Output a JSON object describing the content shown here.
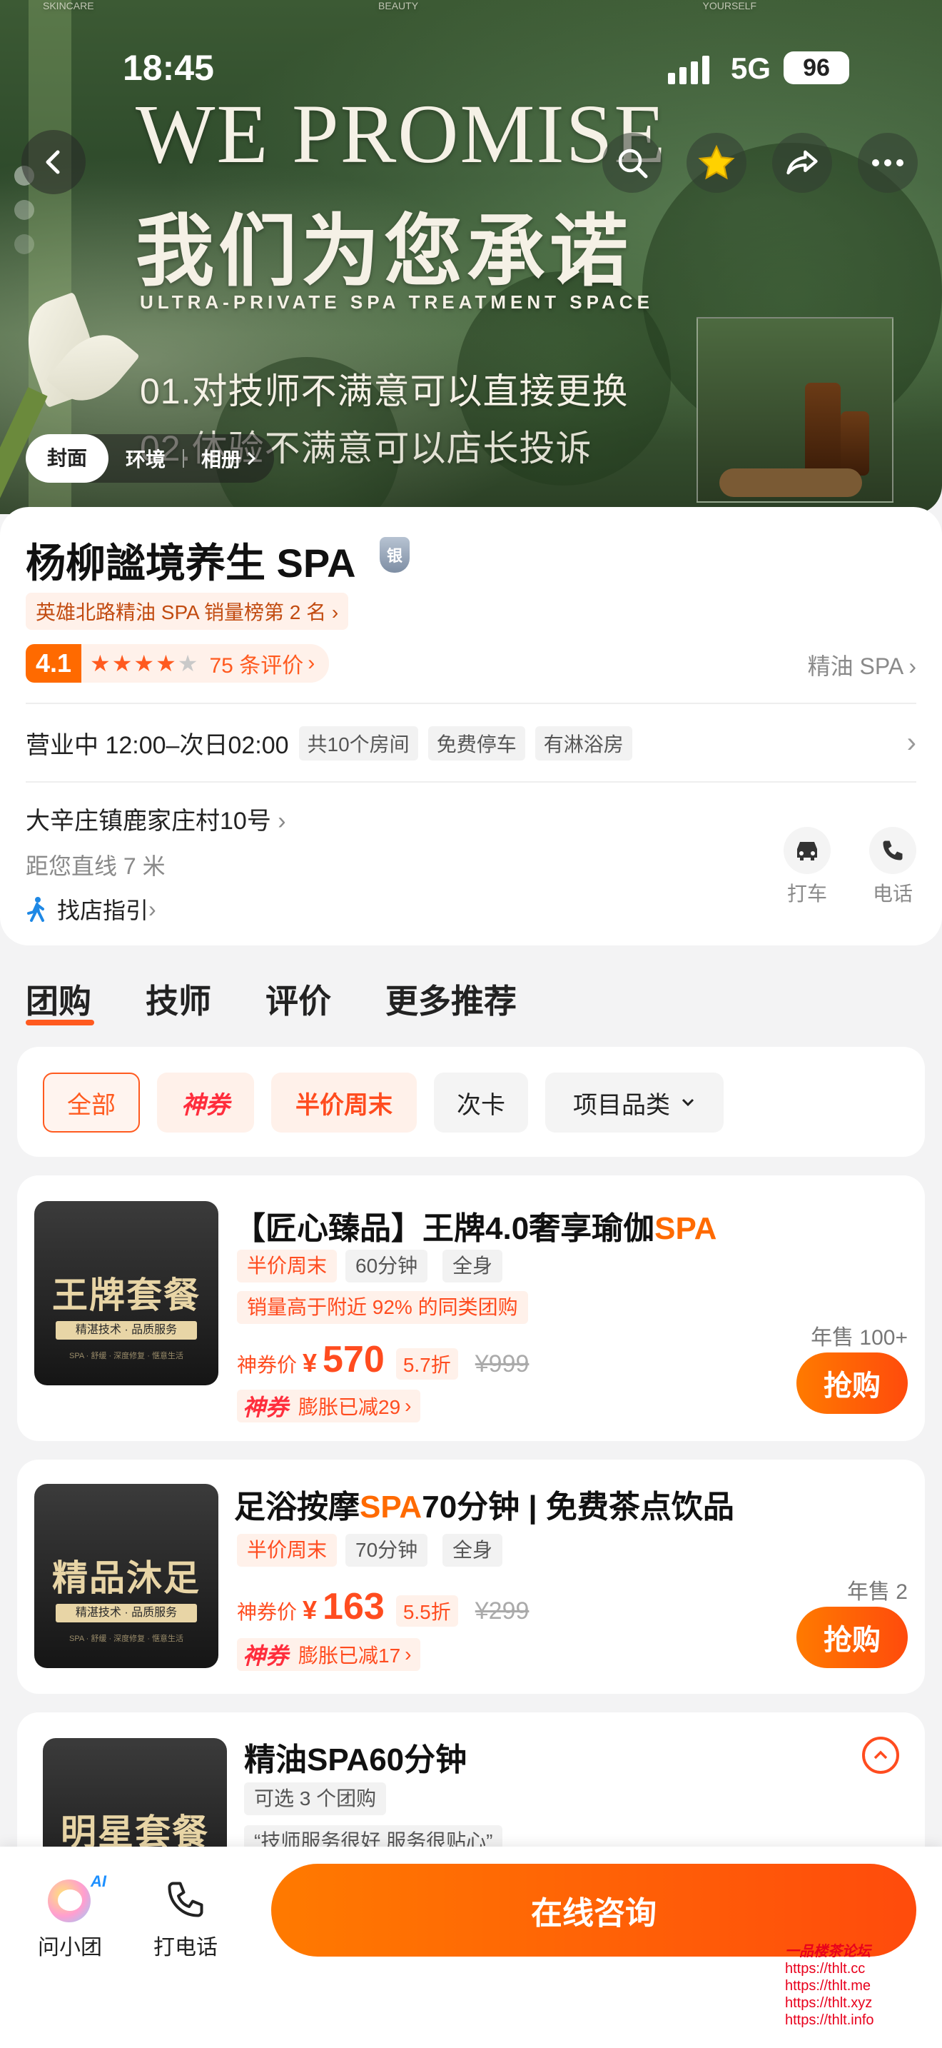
{
  "status_bar": {
    "time": "18:45",
    "network": "5G",
    "battery": "96"
  },
  "hero": {
    "top_labels": [
      "SKINCARE",
      "BEAUTY",
      "YOURSELF"
    ],
    "headline_en": "WE PROMISE",
    "headline_cn": "我们为您承诺",
    "subline": "ULTRA-PRIVATE SPA TREATMENT SPACE",
    "promise_1": "01.对技师不满意可以直接更换",
    "promise_2": "02.体验不满意可以店长投诉",
    "tabs": [
      "封面",
      "环境",
      "相册"
    ]
  },
  "shop": {
    "name": "杨柳謐境养生 SPA",
    "badge": "银",
    "rank": "英雄北路精油 SPA 销量榜第 2 名",
    "score": "4.1",
    "stars": 4,
    "reviews": "75 条评价",
    "category": "精油 SPA",
    "hours": "营业中 12:00–次日02:00",
    "facilities": [
      "共10个房间",
      "免费停车",
      "有淋浴房"
    ],
    "address": "大辛庄镇鹿家庄村10号",
    "distance": "距您直线 7 米",
    "guide": "找店指引",
    "actions": [
      "打车",
      "电话"
    ]
  },
  "nav_tabs": [
    "团购",
    "技师",
    "评价",
    "更多推荐"
  ],
  "filters": [
    "全部",
    "神券",
    "半价周末",
    "次卡",
    "项目品类"
  ],
  "deals": [
    {
      "thumb_title": "王牌套餐",
      "thumb_band": "精湛技术 · 品质服务",
      "thumb_tiny": "SPA · 舒缓 · 深度修复 · 惬意生活",
      "title_pre": "【匠心臻品】王牌4.0奢享瑜伽",
      "title_hl": "SPA",
      "title_post": "",
      "tags": [
        "半价周末",
        "60分钟",
        "全身"
      ],
      "highlight": "销量高于附近 92% 的同类团购",
      "price_label": "神券价",
      "currency": "¥",
      "price": "570",
      "discount": "5.7折",
      "original": "¥999",
      "coupon_label": "神券",
      "coupon_text": "膨胀已减29",
      "annual": "年售 100+",
      "buy": "抢购"
    },
    {
      "thumb_title": "精品沐足",
      "thumb_band": "精湛技术 · 品质服务",
      "thumb_tiny": "SPA · 舒缓 · 深度修复 · 惬意生活",
      "title_pre": "足浴按摩",
      "title_hl": "SPA",
      "title_post": "70分钟 | 免费茶点饮品",
      "tags": [
        "半价周末",
        "70分钟",
        "全身"
      ],
      "price_label": "神券价",
      "currency": "¥",
      "price": "163",
      "discount": "5.5折",
      "original": "¥299",
      "coupon_label": "神券",
      "coupon_text": "膨胀已减17",
      "annual": "年售 2",
      "buy": "抢购"
    },
    {
      "thumb_title": "明星套餐",
      "title": "精油SPA60分钟",
      "option": "可选 3 个团购",
      "quote": "“技师服务很好 服务很贴心”"
    }
  ],
  "bottom": {
    "assistant": "问小团",
    "ai_badge": "AI",
    "call": "打电话",
    "consult": "在线咨询"
  },
  "watermark": [
    "一品楼茶论坛",
    "https://thlt.cc",
    "https://thlt.me",
    "https://thlt.xyz",
    "https://thlt.info"
  ],
  "colors": {
    "accent": "#ff6a00",
    "accent_red": "#ff4c1f",
    "bg": "#f3f3f4"
  }
}
